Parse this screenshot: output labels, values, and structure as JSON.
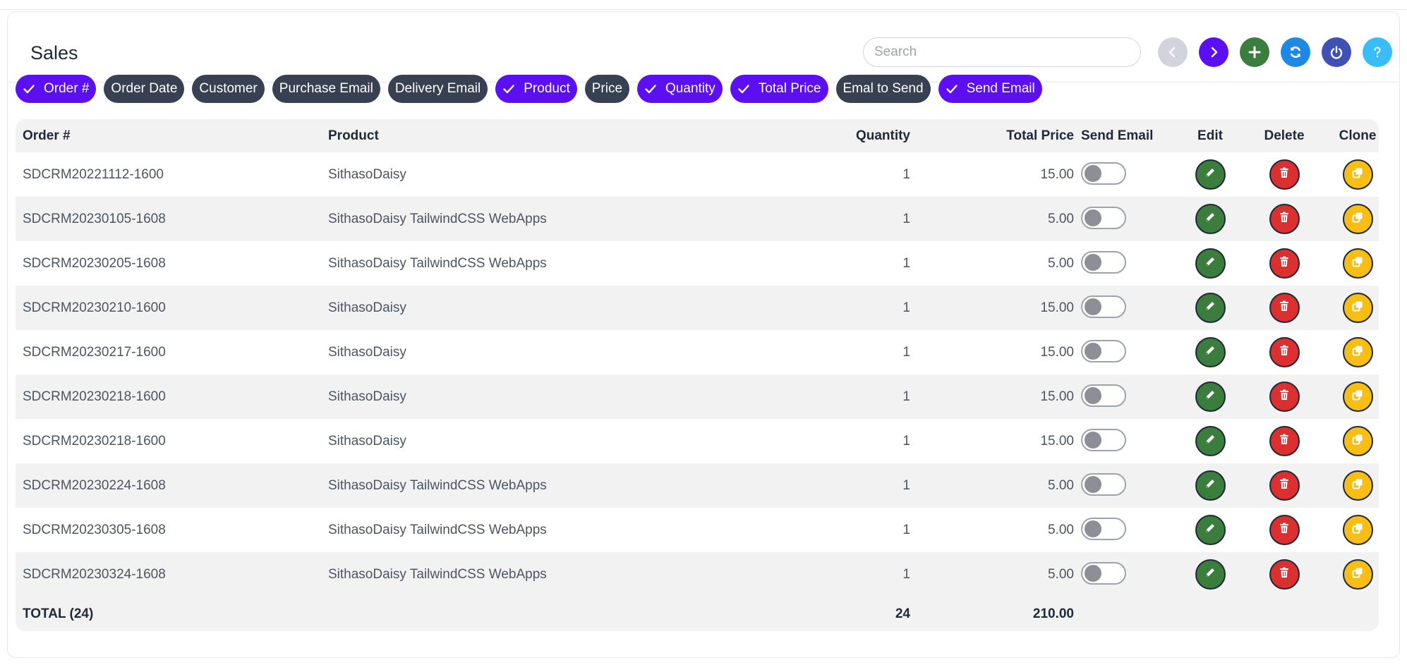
{
  "page": {
    "title": "Sales"
  },
  "search": {
    "placeholder": "Search",
    "value": ""
  },
  "toolbar": {
    "buttons": [
      {
        "name": "prev-page-button",
        "icon": "chevron-left-icon",
        "color": "#d1d5db"
      },
      {
        "name": "next-page-button",
        "icon": "chevron-right-icon",
        "color": "#5b0ff2"
      },
      {
        "name": "add-button",
        "icon": "plus-icon",
        "color": "#3a7d3c"
      },
      {
        "name": "refresh-button",
        "icon": "refresh-icon",
        "color": "#1e88e5"
      },
      {
        "name": "power-button",
        "icon": "power-icon",
        "color": "#3f51b5"
      },
      {
        "name": "help-button",
        "icon": "question-icon",
        "color": "#38bdf8"
      }
    ]
  },
  "column_chips": [
    {
      "label": "Order #",
      "selected": true
    },
    {
      "label": "Order Date",
      "selected": false
    },
    {
      "label": "Customer",
      "selected": false
    },
    {
      "label": "Purchase Email",
      "selected": false
    },
    {
      "label": "Delivery Email",
      "selected": false
    },
    {
      "label": "Product",
      "selected": true
    },
    {
      "label": "Price",
      "selected": false
    },
    {
      "label": "Quantity",
      "selected": true
    },
    {
      "label": "Total Price",
      "selected": true
    },
    {
      "label": "Emal to Send",
      "selected": false
    },
    {
      "label": "Send Email",
      "selected": true
    }
  ],
  "table": {
    "headers": {
      "order": "Order #",
      "product": "Product",
      "quantity": "Quantity",
      "total": "Total Price",
      "send": "Send Email",
      "edit": "Edit",
      "delete": "Delete",
      "clone": "Clone"
    },
    "rows": [
      {
        "order": "SDCRM20221112-1600",
        "product": "SithasoDaisy",
        "quantity": "1",
        "total": "15.00",
        "send_email": false
      },
      {
        "order": "SDCRM20230105-1608",
        "product": "SithasoDaisy TailwindCSS WebApps",
        "quantity": "1",
        "total": "5.00",
        "send_email": false
      },
      {
        "order": "SDCRM20230205-1608",
        "product": "SithasoDaisy TailwindCSS WebApps",
        "quantity": "1",
        "total": "5.00",
        "send_email": false
      },
      {
        "order": "SDCRM20230210-1600",
        "product": "SithasoDaisy",
        "quantity": "1",
        "total": "15.00",
        "send_email": false
      },
      {
        "order": "SDCRM20230217-1600",
        "product": "SithasoDaisy",
        "quantity": "1",
        "total": "15.00",
        "send_email": false
      },
      {
        "order": "SDCRM20230218-1600",
        "product": "SithasoDaisy",
        "quantity": "1",
        "total": "15.00",
        "send_email": false
      },
      {
        "order": "SDCRM20230218-1600",
        "product": "SithasoDaisy",
        "quantity": "1",
        "total": "15.00",
        "send_email": false
      },
      {
        "order": "SDCRM20230224-1608",
        "product": "SithasoDaisy TailwindCSS WebApps",
        "quantity": "1",
        "total": "5.00",
        "send_email": false
      },
      {
        "order": "SDCRM20230305-1608",
        "product": "SithasoDaisy TailwindCSS WebApps",
        "quantity": "1",
        "total": "5.00",
        "send_email": false
      },
      {
        "order": "SDCRM20230324-1608",
        "product": "SithasoDaisy TailwindCSS WebApps",
        "quantity": "1",
        "total": "5.00",
        "send_email": false
      }
    ],
    "footer": {
      "label": "TOTAL (24)",
      "quantity": "24",
      "total": "210.00"
    }
  },
  "colors": {
    "accent": "#5b0ff2",
    "chip_off": "#374151",
    "edit": "#3a7d3c",
    "delete": "#dc2f2f",
    "clone": "#f8be14"
  }
}
